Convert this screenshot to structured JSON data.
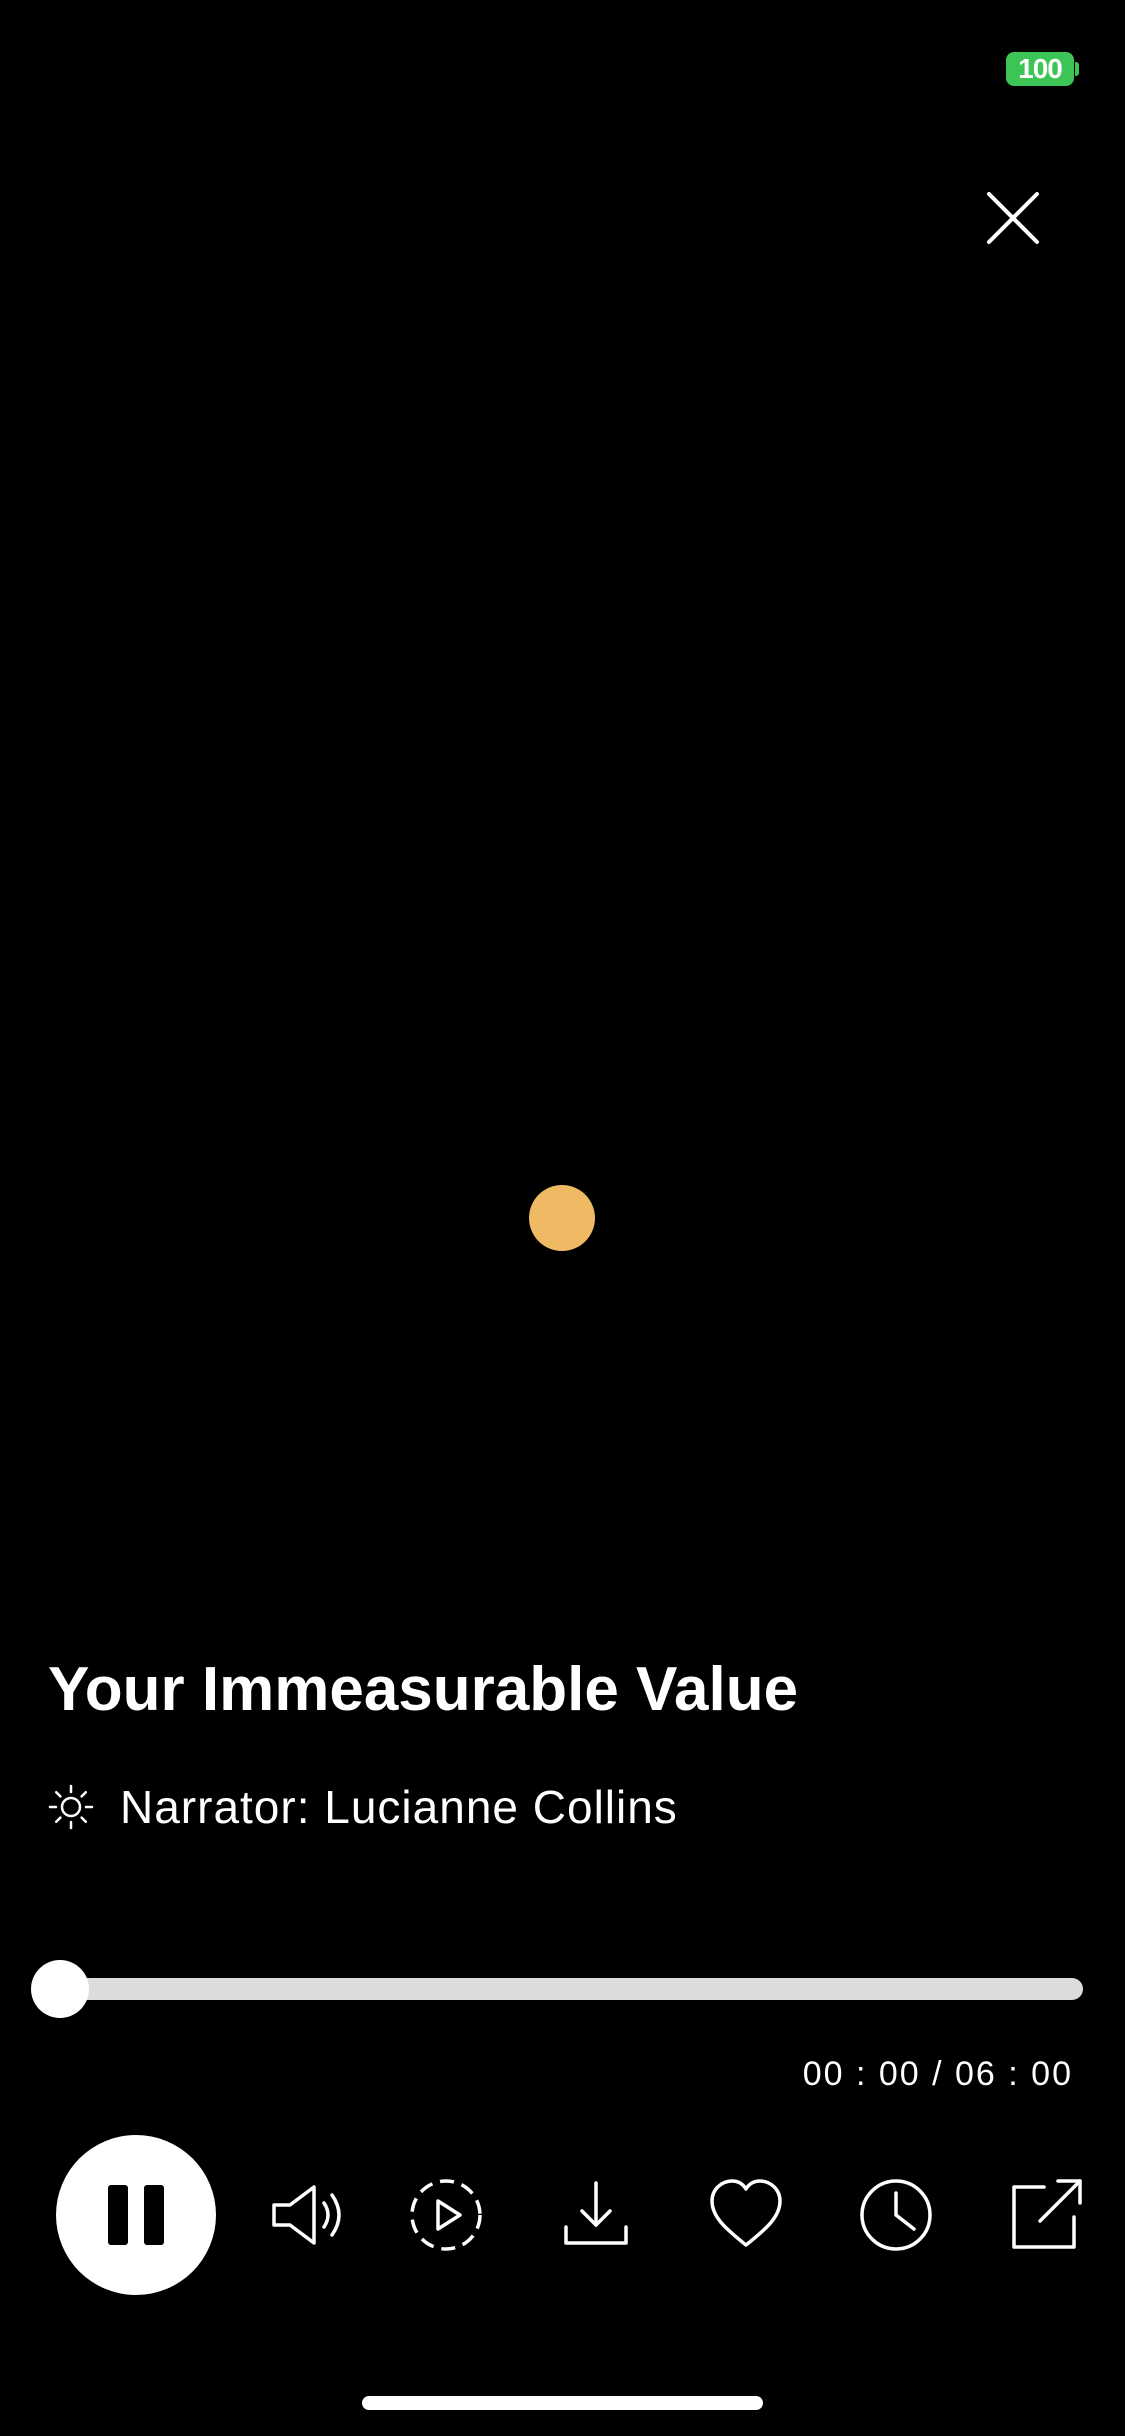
{
  "status_bar": {
    "battery_level": "100",
    "battery_color": "#3cc456"
  },
  "close_icon": "close-icon",
  "visual": {
    "orb_color": "#f0b964"
  },
  "track": {
    "title": "Your Immeasurable Value",
    "narrator": "Narrator: Lucianne Collins",
    "narrator_icon": "sun-icon"
  },
  "playback": {
    "progress_fraction": 0,
    "elapsed": "00 : 00",
    "separator": "/",
    "duration": "06 : 00",
    "time_display": "00 : 00 / 06 : 00",
    "state": "playing"
  },
  "controls": [
    {
      "name": "pause-icon"
    },
    {
      "name": "volume-icon"
    },
    {
      "name": "autoplay-icon"
    },
    {
      "name": "download-icon"
    },
    {
      "name": "heart-icon"
    },
    {
      "name": "clock-icon"
    },
    {
      "name": "share-icon"
    }
  ]
}
